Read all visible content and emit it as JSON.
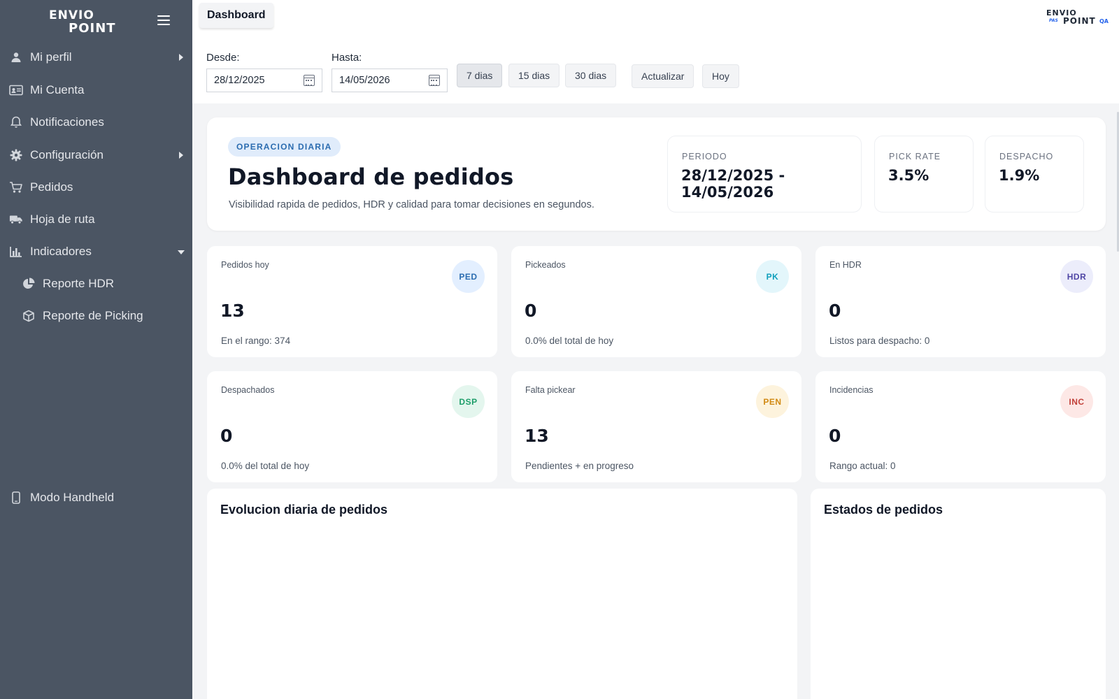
{
  "sidebar": {
    "brand_top": "ENVIO",
    "brand_bottom": "POINT",
    "items": [
      {
        "label": "Mi perfil",
        "icon": "user-icon"
      },
      {
        "label": "Mi Cuenta",
        "icon": "id-card-icon"
      },
      {
        "label": "Notificaciones",
        "icon": "bell-icon"
      },
      {
        "label": "Configuración",
        "icon": "gear-icon"
      },
      {
        "label": "Pedidos",
        "icon": "cart-icon"
      },
      {
        "label": "Hoja de ruta",
        "icon": "truck-icon"
      },
      {
        "label": "Indicadores",
        "icon": "bar-chart-icon"
      },
      {
        "label": "Reporte HDR",
        "icon": "pie-chart-icon"
      },
      {
        "label": "Reporte de Picking",
        "icon": "box-icon"
      },
      {
        "label": "Modo Handheld",
        "icon": "mobile-icon"
      }
    ]
  },
  "header": {
    "tab": "Dashboard",
    "logo_top": "ENVIO",
    "logo_bottom": "POINT",
    "logo_pre": "PAS",
    "logo_env": "QA"
  },
  "filters": {
    "desde_label": "Desde:",
    "desde_value": "28/12/2025",
    "hasta_label": "Hasta:",
    "hasta_value": "14/05/2026",
    "btn_7": "7 dias",
    "btn_15": "15 dias",
    "btn_30": "30 dias",
    "btn_refresh": "Actualizar",
    "btn_today": "Hoy"
  },
  "hero": {
    "pill": "OPERACION DIARIA",
    "title": "Dashboard de pedidos",
    "description": "Visibilidad rapida de pedidos, HDR y calidad para tomar decisiones en segundos.",
    "stats": [
      {
        "label": "PERIODO",
        "value": "28/12/2025 - 14/05/2026"
      },
      {
        "label": "PICK RATE",
        "value": "3.5%"
      },
      {
        "label": "DESPACHO",
        "value": "1.9%"
      }
    ]
  },
  "kpis": [
    {
      "title": "Pedidos hoy",
      "badge": "PED",
      "value": "13",
      "sub": "En el rango: 374",
      "badge_bg": "#e3efff",
      "badge_fg": "#2b6cb0"
    },
    {
      "title": "Pickeados",
      "badge": "PK",
      "value": "0",
      "sub": "0.0% del total de hoy",
      "badge_bg": "#e3f6fb",
      "badge_fg": "#0e9fbc"
    },
    {
      "title": "En HDR",
      "badge": "HDR",
      "value": "0",
      "sub": "Listos para despacho: 0",
      "badge_bg": "#ecedfb",
      "badge_fg": "#4f46a5"
    },
    {
      "title": "Despachados",
      "badge": "DSP",
      "value": "0",
      "sub": "0.0% del total de hoy",
      "badge_bg": "#e4f6ee",
      "badge_fg": "#1e9e6a"
    },
    {
      "title": "Falta pickear",
      "badge": "PEN",
      "value": "13",
      "sub": "Pendientes + en progreso",
      "badge_bg": "#fdf3dd",
      "badge_fg": "#d18a14"
    },
    {
      "title": "Incidencias",
      "badge": "INC",
      "value": "0",
      "sub": "Rango actual: 0",
      "badge_bg": "#fde8e6",
      "badge_fg": "#c2413a"
    }
  ],
  "panels": {
    "evolution_title": "Evolucion diaria de pedidos",
    "states_title": "Estados de pedidos"
  }
}
